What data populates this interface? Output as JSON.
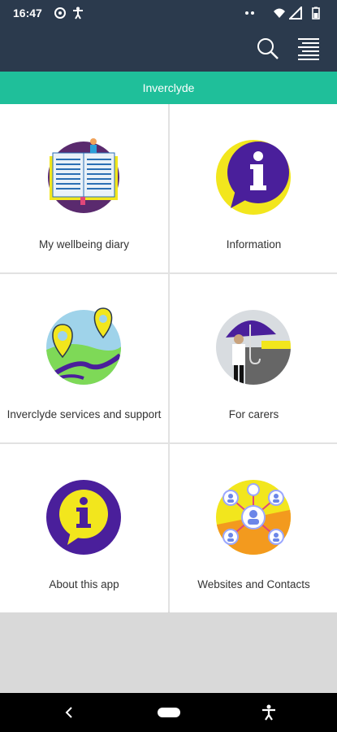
{
  "status_bar": {
    "time": "16:47",
    "left_icons": [
      "at-sign-icon",
      "accessibility-icon"
    ],
    "right_icons": [
      "dots-icon",
      "wifi-icon",
      "signal-icon",
      "battery-icon"
    ]
  },
  "app_bar": {
    "icons": [
      "search-icon",
      "menu-icon"
    ]
  },
  "banner": {
    "title": "Inverclyde"
  },
  "tiles": [
    {
      "label": "My wellbeing diary",
      "icon": "diary-icon"
    },
    {
      "label": "Information",
      "icon": "info-chat-icon"
    },
    {
      "label": "Inverclyde services and support",
      "icon": "map-pins-icon"
    },
    {
      "label": "For carers",
      "icon": "umbrella-carer-icon"
    },
    {
      "label": "About this app",
      "icon": "about-info-icon"
    },
    {
      "label": "Websites and Contacts",
      "icon": "contacts-network-icon"
    }
  ],
  "colors": {
    "header": "#2b3a4d",
    "banner": "#1fbf9a",
    "yellow": "#f2e61d",
    "purple": "#4a1f9b"
  },
  "nav_bar": {
    "icons": [
      "back-icon",
      "home-pill-icon",
      "accessibility-icon"
    ]
  }
}
